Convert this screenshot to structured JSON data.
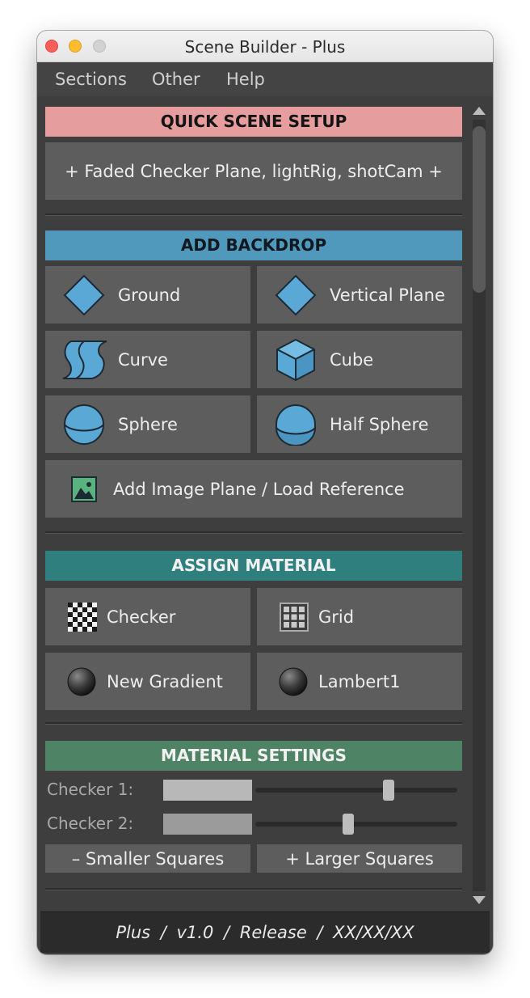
{
  "window": {
    "title": "Scene Builder - Plus"
  },
  "menubar": {
    "items": [
      "Sections",
      "Other",
      "Help"
    ]
  },
  "quick_setup": {
    "header": "QUICK SCENE SETUP",
    "button": "+ Faded Checker Plane, lightRig, shotCam +"
  },
  "backdrop": {
    "header": "ADD BACKDROP",
    "buttons": [
      {
        "label": "Ground",
        "icon": "diamond-icon"
      },
      {
        "label": "Vertical Plane",
        "icon": "diamond-icon"
      },
      {
        "label": "Curve",
        "icon": "curve-icon"
      },
      {
        "label": "Cube",
        "icon": "cube-icon"
      },
      {
        "label": "Sphere",
        "icon": "sphere-icon"
      },
      {
        "label": "Half Sphere",
        "icon": "half-sphere-icon"
      }
    ],
    "image_plane": {
      "label": "Add Image Plane / Load Reference",
      "icon": "image-icon"
    }
  },
  "material": {
    "header": "ASSIGN MATERIAL",
    "buttons": [
      {
        "label": "Checker",
        "icon": "checker-icon"
      },
      {
        "label": "Grid",
        "icon": "grid-icon"
      },
      {
        "label": "New Gradient",
        "icon": "shader-ball-icon"
      },
      {
        "label": "Lambert1",
        "icon": "shader-ball-icon"
      }
    ]
  },
  "settings": {
    "header": "MATERIAL SETTINGS",
    "checker1": {
      "label": "Checker 1:",
      "color": "#b8b8b8",
      "value": 0.66
    },
    "checker2": {
      "label": "Checker 2:",
      "color": "#9b9b9b",
      "value": 0.46
    },
    "smaller": "– Smaller Squares",
    "larger": "+ Larger Squares"
  },
  "footer": {
    "text": "Plus / v1.0 / Release / XX/XX/XX"
  },
  "colors": {
    "quick_setup": "#e59d9e",
    "backdrop": "#5198bd",
    "material": "#2e7f7e",
    "settings": "#4e8465"
  }
}
